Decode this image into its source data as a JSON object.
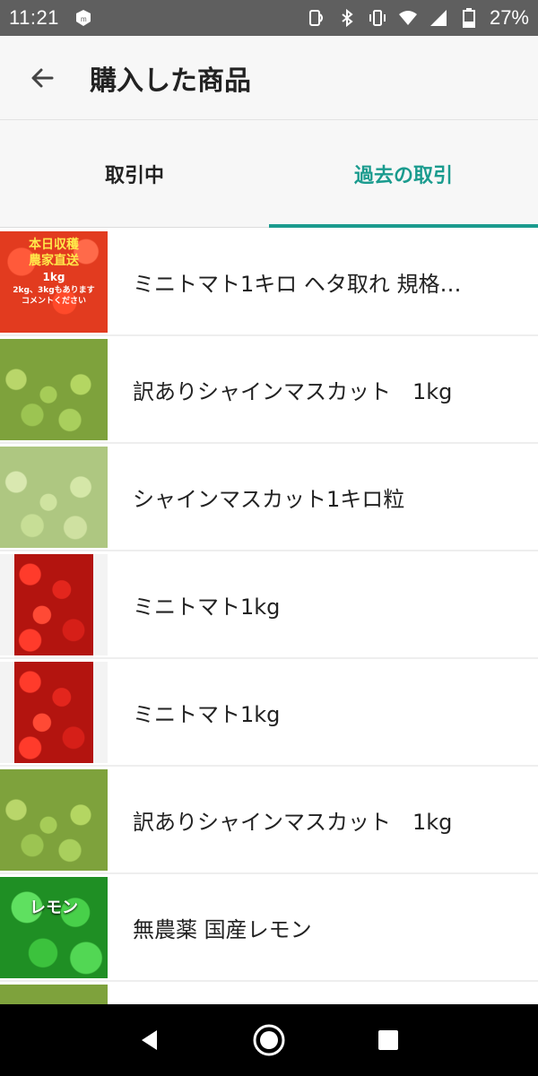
{
  "status_bar": {
    "time": "11:21",
    "battery": "27%",
    "icons": [
      "app-notification-icon",
      "nfc-icon",
      "bluetooth-icon",
      "vibrate-icon",
      "wifi-icon",
      "signal-icon",
      "battery-icon"
    ]
  },
  "header": {
    "title": "購入した商品",
    "back_icon": "arrow-left-icon"
  },
  "tabs": [
    {
      "label": "取引中",
      "active": false
    },
    {
      "label": "過去の取引",
      "active": true
    }
  ],
  "items": [
    {
      "title": "ミニトマト1キロ ヘタ取れ 規格…",
      "thumb": "tomato-promo",
      "promo": {
        "line1": "本日収穫",
        "line2": "農家直送",
        "weight": "1kg",
        "note1": "2kg、3kgもあります",
        "note2": "コメントください"
      }
    },
    {
      "title": "訳ありシャインマスカット　1kg",
      "thumb": "grape"
    },
    {
      "title": "シャインマスカット1キロ粒",
      "thumb": "grape-white"
    },
    {
      "title": "ミニトマト1kg",
      "thumb": "cherry"
    },
    {
      "title": "ミニトマト1kg",
      "thumb": "cherry"
    },
    {
      "title": "訳ありシャインマスカット　1kg",
      "thumb": "grape"
    },
    {
      "title": "無農薬 国産レモン",
      "thumb": "lemon",
      "thumb_text": "レモン"
    },
    {
      "title": "",
      "thumb": "grape"
    }
  ],
  "colors": {
    "accent": "#1a9b8e",
    "status_bar": "#5f5f5f",
    "app_bar": "#f7f7f7",
    "nav_bar": "#000000"
  },
  "nav": {
    "back": "triangle-back-icon",
    "home": "circle-home-icon",
    "recents": "square-recents-icon"
  }
}
